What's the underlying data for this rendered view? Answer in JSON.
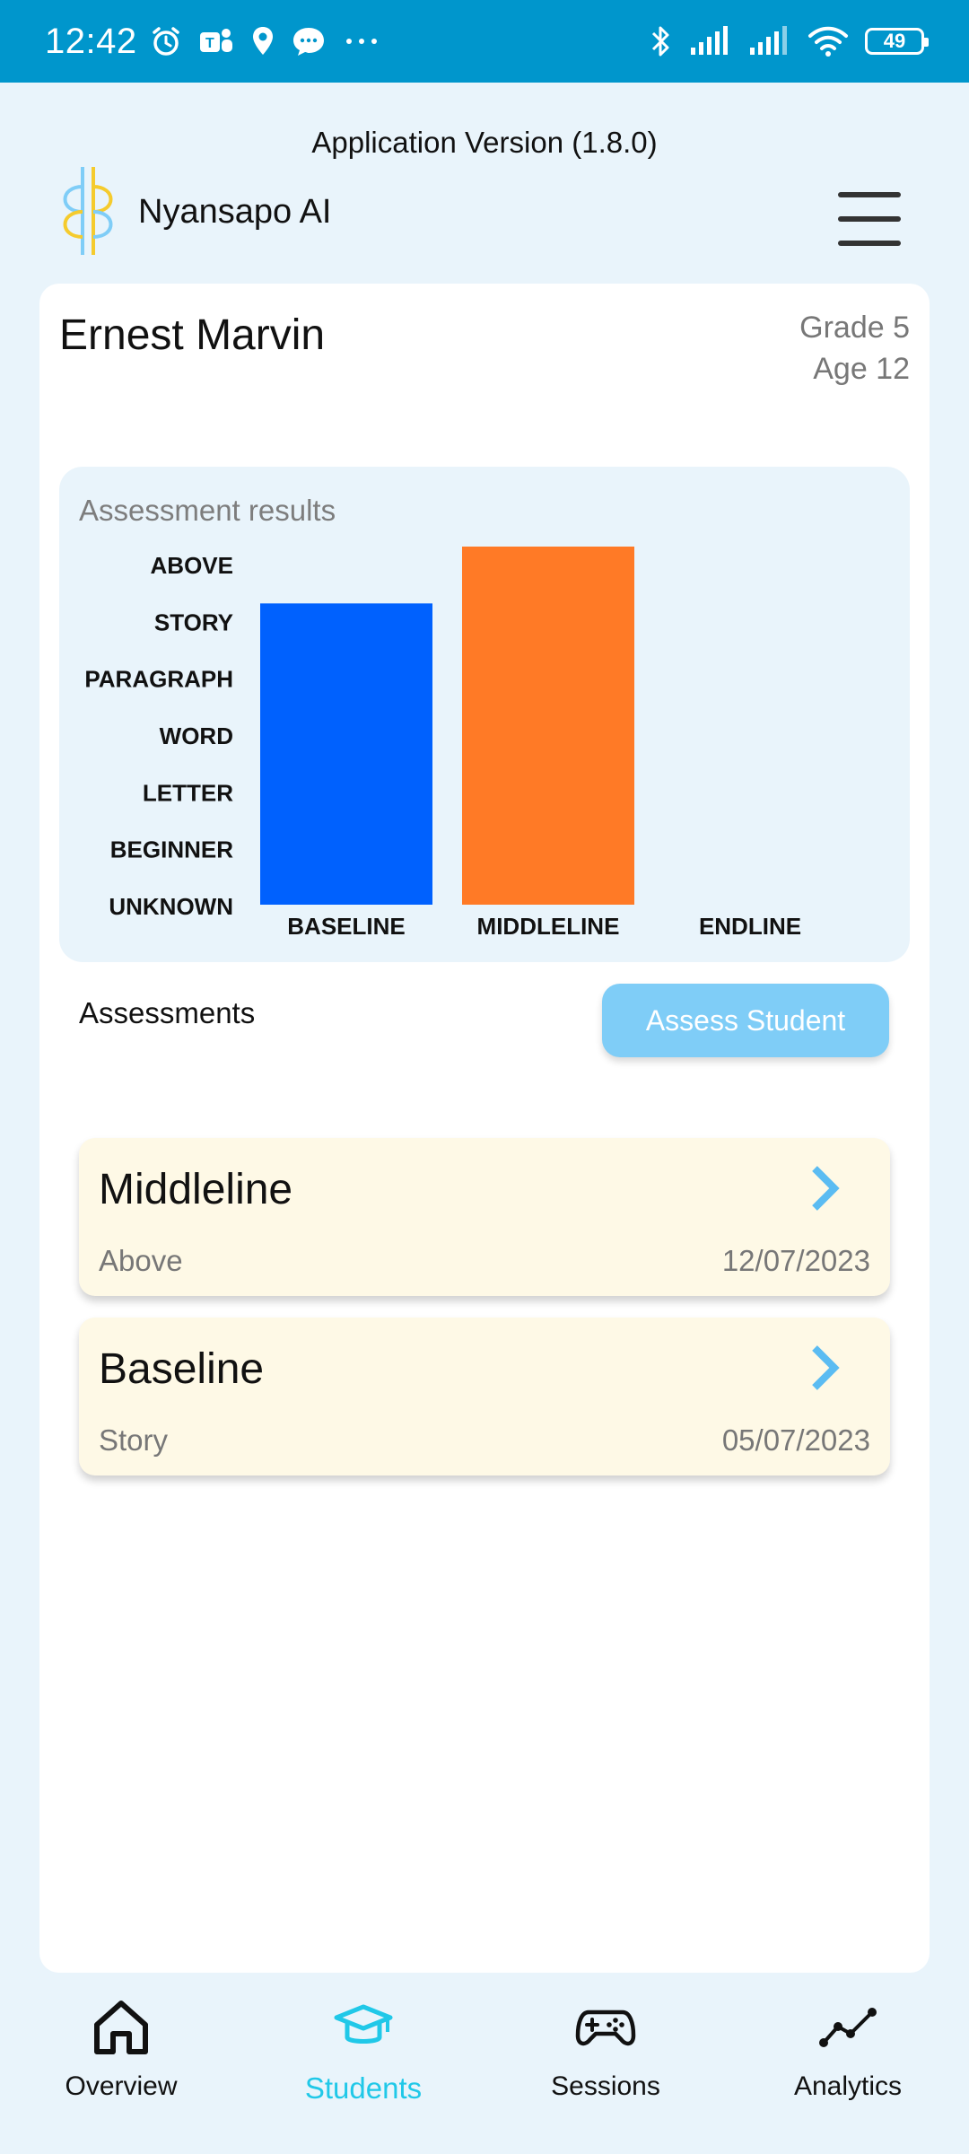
{
  "status_bar": {
    "time": "12:42",
    "battery": "49",
    "left_icons": [
      "alarm-icon",
      "teams-icon",
      "location-icon",
      "chat-icon",
      "more-icon"
    ],
    "right_icons": [
      "bluetooth-icon",
      "signal-icon",
      "signal-icon",
      "wifi-icon",
      "battery-icon"
    ]
  },
  "header": {
    "app_version": "Application Version (1.8.0)",
    "brand_name": "Nyansapo AI",
    "menu_icon": "hamburger-menu-icon"
  },
  "student": {
    "name": "Ernest Marvin",
    "grade": "Grade 5",
    "age": "Age 12"
  },
  "chart": {
    "title": "Assessment results"
  },
  "chart_data": {
    "type": "bar",
    "title": "Assessment results",
    "y_levels": [
      "UNKNOWN",
      "BEGINNER",
      "LETTER",
      "WORD",
      "PARAGRAPH",
      "STORY",
      "ABOVE"
    ],
    "categories": [
      "BASELINE",
      "MIDDLELINE",
      "ENDLINE"
    ],
    "values": [
      "STORY",
      "ABOVE",
      null
    ],
    "level_index": [
      5,
      6,
      null
    ],
    "colors": [
      "#0061fe",
      "#ff7a26",
      null
    ],
    "grid": false,
    "legend": "none"
  },
  "assessments": {
    "label": "Assessments",
    "button_label": "Assess Student",
    "items": [
      {
        "title": "Middleline",
        "level": "Above",
        "date": "12/07/2023"
      },
      {
        "title": "Baseline",
        "level": "Story",
        "date": "05/07/2023"
      }
    ]
  },
  "nav": {
    "items": [
      {
        "label": "Overview",
        "icon": "home-icon",
        "active": false
      },
      {
        "label": "Students",
        "icon": "graduation-cap-icon",
        "active": true
      },
      {
        "label": "Sessions",
        "icon": "gamepad-icon",
        "active": false
      },
      {
        "label": "Analytics",
        "icon": "line-chart-icon",
        "active": false
      }
    ],
    "active_color": "#20c8e8"
  }
}
